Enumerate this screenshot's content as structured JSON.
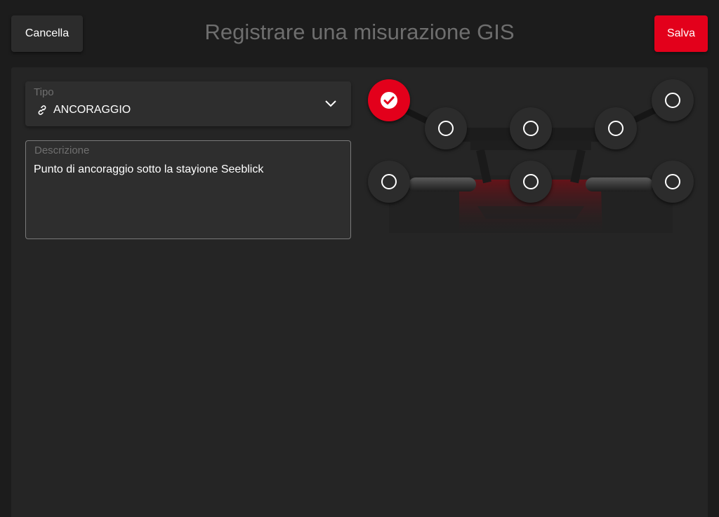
{
  "header": {
    "cancel_label": "Cancella",
    "title": "Registrare una misurazione GIS",
    "save_label": "Salva"
  },
  "form": {
    "type_field": {
      "label": "Tipo",
      "value": "ANCORAGGIO",
      "icon": "link-icon"
    },
    "description_field": {
      "label": "Descrizione",
      "value": "Punto di ancoraggio sotto la stayione Seeblick"
    }
  },
  "anchor_points": [
    {
      "id": "point-1",
      "selected": true
    },
    {
      "id": "point-2",
      "selected": false
    },
    {
      "id": "point-3",
      "selected": false
    },
    {
      "id": "point-4",
      "selected": false
    },
    {
      "id": "point-5",
      "selected": false
    },
    {
      "id": "point-6",
      "selected": false
    },
    {
      "id": "point-7",
      "selected": false
    },
    {
      "id": "point-8",
      "selected": false
    }
  ],
  "colors": {
    "accent": "#e3001b",
    "background": "#1c1c1c",
    "panel": "#252525"
  }
}
